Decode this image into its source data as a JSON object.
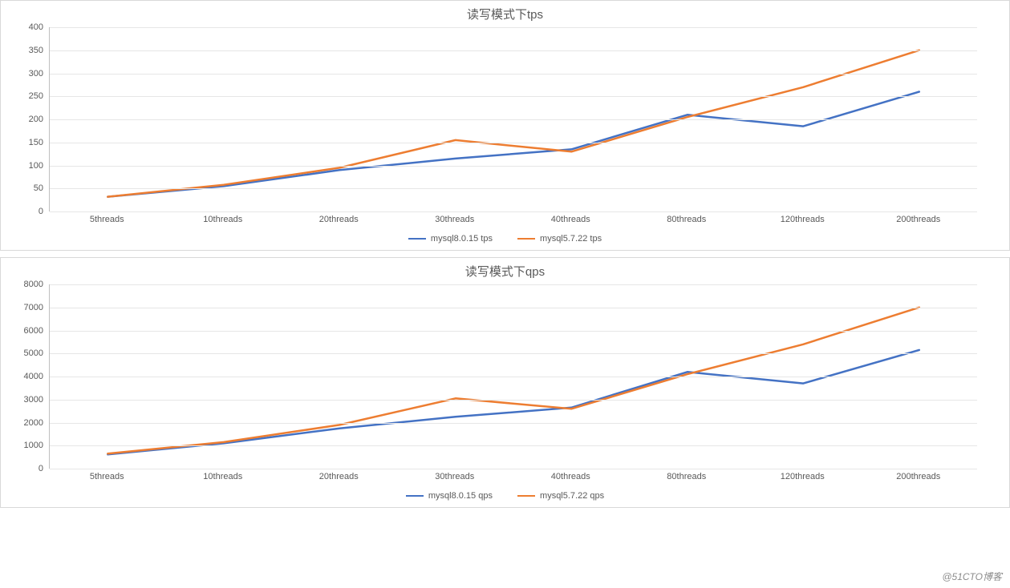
{
  "watermark": "@51CTO博客",
  "colors": {
    "series_a": "#4472C4",
    "series_b": "#ED7D31"
  },
  "chart_data": [
    {
      "id": "tps",
      "type": "line",
      "title": "读写模式下tps",
      "xlabel": "",
      "ylabel": "",
      "categories": [
        "5threads",
        "10threads",
        "20threads",
        "30threads",
        "40threads",
        "80threads",
        "120threads",
        "200threads"
      ],
      "ylim": [
        0,
        400
      ],
      "ystep": 50,
      "series": [
        {
          "name": "mysql8.0.15 tps",
          "color_key": "series_a",
          "values": [
            32,
            55,
            90,
            115,
            135,
            210,
            185,
            260
          ]
        },
        {
          "name": "mysql5.7.22 tps",
          "color_key": "series_b",
          "values": [
            32,
            58,
            95,
            155,
            130,
            205,
            270,
            350
          ]
        }
      ],
      "legend_text": {
        "a": "mysql8.0.15 tps",
        "b": "mysql5.7.22 tps"
      }
    },
    {
      "id": "qps",
      "type": "line",
      "title": "读写模式下qps",
      "xlabel": "",
      "ylabel": "",
      "categories": [
        "5threads",
        "10threads",
        "20threads",
        "30threads",
        "40threads",
        "80threads",
        "120threads",
        "200threads"
      ],
      "ylim": [
        0,
        8000
      ],
      "ystep": 1000,
      "series": [
        {
          "name": "mysql8.0.15 qps",
          "color_key": "series_a",
          "values": [
            620,
            1100,
            1750,
            2250,
            2650,
            4200,
            3700,
            5150
          ]
        },
        {
          "name": "mysql5.7.22 qps",
          "color_key": "series_b",
          "values": [
            650,
            1150,
            1900,
            3050,
            2600,
            4100,
            5400,
            7000
          ]
        }
      ],
      "legend_text": {
        "a": "mysql8.0.15 qps",
        "b": "mysql5.7.22 qps"
      }
    }
  ]
}
